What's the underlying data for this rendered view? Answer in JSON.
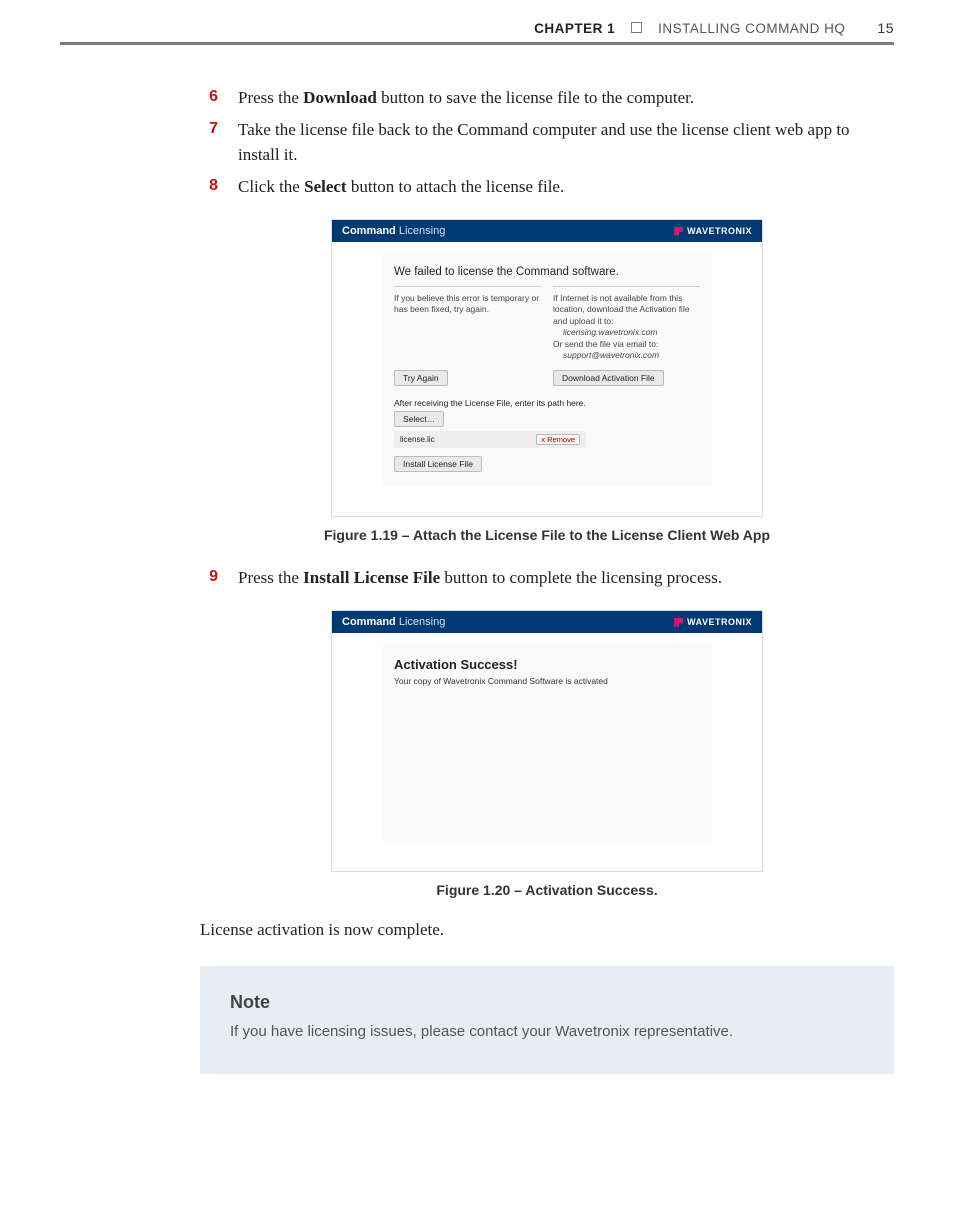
{
  "header": {
    "chapter_label": "CHAPTER 1",
    "chapter_title": "INSTALLING COMMAND HQ",
    "page_number": "15"
  },
  "steps_a": [
    {
      "num": "6",
      "html": "Press the <b>Download</b> button to save the license file to the computer."
    },
    {
      "num": "7",
      "html": "Take the license file back to the Command computer and use the license client web app to install it."
    },
    {
      "num": "8",
      "html": "Click the <b>Select</b> button to attach the license file."
    }
  ],
  "fig1": {
    "caption": "Figure 1.19 – Attach the License File to the License Client Web App",
    "brand_bold": "Command",
    "brand_light": "Licensing",
    "brand_right": "WAVETRONIX",
    "panel_title": "We failed to license the Command software.",
    "left_col": "If you believe this error is temporary or has been fixed, try again.",
    "right_col_line1": "If Internet is not available from this location, download the Activation file and upload it to:",
    "right_col_indent1": "licensing.wavetronix.com",
    "right_col_line2": "Or send the file via email to:",
    "right_col_indent2": "support@wavetronix.com",
    "btn_try": "Try Again",
    "btn_dl": "Download Activation File",
    "sub_text": "After receiving the License File, enter its path here.",
    "btn_select": "Select…",
    "file_name": "license.lic",
    "btn_remove": "x Remove",
    "btn_install": "Install License File"
  },
  "steps_b": [
    {
      "num": "9",
      "html": "Press the <b>Install License File</b> button to complete the licensing process."
    }
  ],
  "fig2": {
    "caption": "Figure 1.20 – Activation Success.",
    "brand_bold": "Command",
    "brand_light": "Licensing",
    "brand_right": "WAVETRONIX",
    "success_title": "Activation Success!",
    "success_sub": "Your copy of Wavetronix Command Software is activated"
  },
  "post_text": "License activation is now complete.",
  "note": {
    "title": "Note",
    "body": "If you have licensing issues, please contact your Wavetronix representative."
  }
}
